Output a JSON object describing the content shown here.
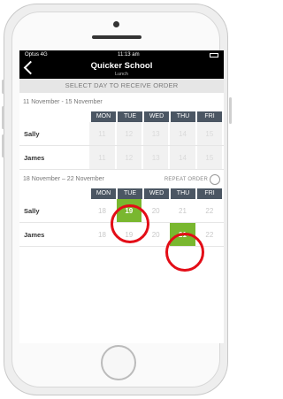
{
  "status": {
    "carrier": "Optus 4G",
    "time": "11:13 am"
  },
  "nav": {
    "title": "Quicker School",
    "subtitle": "Lunch"
  },
  "instruction": "SELECT DAY TO RECEIVE ORDER",
  "week1": {
    "range": "11 November - 15 November",
    "days": [
      "MON",
      "TUE",
      "WED",
      "THU",
      "FRI"
    ],
    "rows": [
      {
        "name": "Sally",
        "dates": [
          "11",
          "12",
          "13",
          "14",
          "15"
        ]
      },
      {
        "name": "James",
        "dates": [
          "11",
          "12",
          "13",
          "14",
          "15"
        ]
      }
    ]
  },
  "week2": {
    "range": "18 November – 22 November",
    "repeat_label": "REPEAT ORDER",
    "days": [
      "MON",
      "TUE",
      "WED",
      "THU",
      "FRI"
    ],
    "rows": [
      {
        "name": "Sally",
        "dates": [
          "18",
          "19",
          "20",
          "21",
          "22"
        ],
        "selected": 1
      },
      {
        "name": "James",
        "dates": [
          "18",
          "19",
          "20",
          "21",
          "22"
        ],
        "selected": 3
      }
    ]
  },
  "colors": {
    "header_bg": "#4b5663",
    "selected": "#79b72f",
    "highlight_circle": "#e30d17"
  }
}
